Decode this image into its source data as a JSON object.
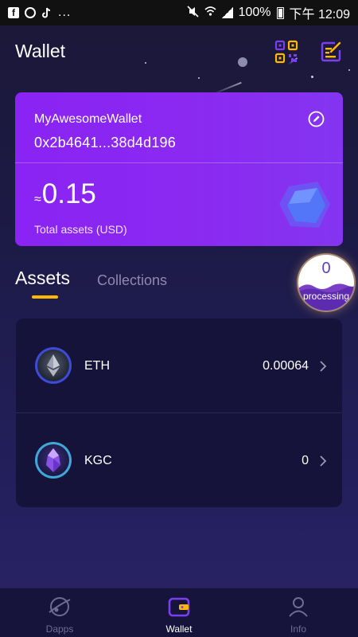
{
  "status_bar": {
    "left_icons": [
      "facebook-icon",
      "sync-icon",
      "tiktok-icon"
    ],
    "more": "...",
    "battery": "100%",
    "time": "下午 12:09"
  },
  "header": {
    "title": "Wallet",
    "qr_icon": "qr-code-icon",
    "edit_icon": "edit-note-icon"
  },
  "wallet_card": {
    "name": "MyAwesomeWallet",
    "address": "0x2b4641...38d4d196",
    "approx_symbol": "≈",
    "balance": "0.15",
    "total_label": "Total assets (USD)"
  },
  "tabs": [
    {
      "label": "Assets",
      "active": true
    },
    {
      "label": "Collections",
      "active": false
    }
  ],
  "processing": {
    "count": "0",
    "label": "processing"
  },
  "assets": [
    {
      "symbol": "ETH",
      "amount": "0.00064",
      "icon": "ethereum-icon"
    },
    {
      "symbol": "KGC",
      "amount": "0",
      "icon": "kgc-crystal-icon"
    }
  ],
  "bottom_nav": [
    {
      "label": "Dapps",
      "icon": "planet-icon",
      "active": false
    },
    {
      "label": "Wallet",
      "icon": "wallet-icon",
      "active": true
    },
    {
      "label": "Info",
      "icon": "user-icon",
      "active": false
    }
  ],
  "colors": {
    "background": "#1c1a45",
    "card": "#8a23f3",
    "accent_yellow": "#ffb800",
    "accent_purple": "#7b3ff2",
    "list_bg": "#16133a"
  }
}
